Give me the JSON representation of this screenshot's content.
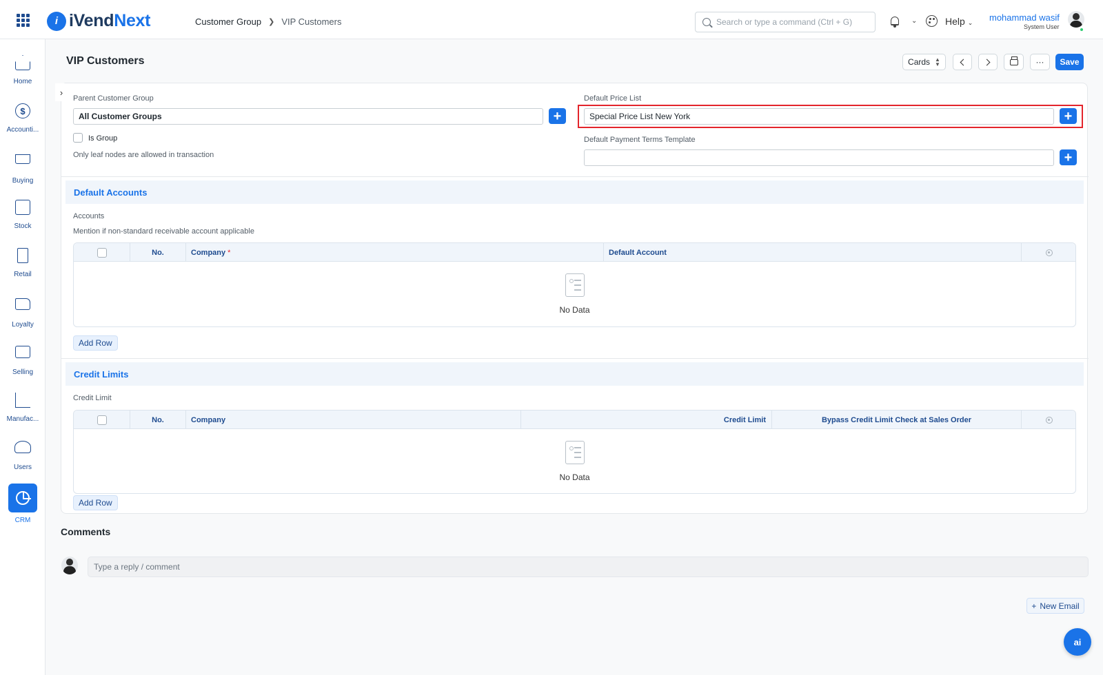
{
  "app": {
    "logo_prefix": "iVend",
    "logo_suffix": "Next"
  },
  "breadcrumb": {
    "parent": "Customer Group",
    "current": "VIP Customers"
  },
  "search": {
    "placeholder": "Search or type a command (Ctrl + G)"
  },
  "header": {
    "help_label": "Help",
    "user_name": "mohammad wasif",
    "user_role": "System User"
  },
  "sidebar": {
    "items": [
      {
        "label": "Home",
        "icon": "home-icon"
      },
      {
        "label": "Accounti...",
        "icon": "dollar-icon"
      },
      {
        "label": "Buying",
        "icon": "cart-icon"
      },
      {
        "label": "Stock",
        "icon": "box-icon"
      },
      {
        "label": "Retail",
        "icon": "retail-icon"
      },
      {
        "label": "Loyalty",
        "icon": "folder-icon"
      },
      {
        "label": "Selling",
        "icon": "selling-icon"
      },
      {
        "label": "Manufac...",
        "icon": "factory-icon"
      },
      {
        "label": "Users",
        "icon": "users-icon"
      },
      {
        "label": "CRM",
        "icon": "crm-icon",
        "active": true
      }
    ]
  },
  "page": {
    "title": "VIP Customers"
  },
  "toolbar": {
    "view_label": "Cards",
    "more_label": "···",
    "save_label": "Save"
  },
  "form": {
    "parent_group_label": "Parent Customer Group",
    "parent_group_value": "All Customer Groups",
    "is_group_label": "Is Group",
    "is_group_checked": false,
    "leaf_note": "Only leaf nodes are allowed in transaction",
    "price_list_label": "Default Price List",
    "price_list_value": "Special Price List New York",
    "payment_terms_label": "Default Payment Terms Template",
    "payment_terms_value": ""
  },
  "default_accounts": {
    "title": "Default Accounts",
    "field_label": "Accounts",
    "description": "Mention if non-standard receivable account applicable",
    "columns": {
      "no": "No.",
      "company": "Company",
      "company_required": "*",
      "account": "Default Account"
    },
    "empty_text": "No Data",
    "add_row": "Add Row"
  },
  "credit_limits": {
    "title": "Credit Limits",
    "field_label": "Credit Limit",
    "columns": {
      "no": "No.",
      "company": "Company",
      "limit": "Credit Limit",
      "bypass": "Bypass Credit Limit Check at Sales Order"
    },
    "empty_text": "No Data",
    "add_row": "Add Row"
  },
  "comments": {
    "title": "Comments",
    "placeholder": "Type a reply / comment"
  },
  "actions": {
    "new_email": "New Email",
    "ai": "ai"
  },
  "colors": {
    "primary": "#1a73e8",
    "navy": "#1e4b8f",
    "highlight": "#e3242b"
  }
}
